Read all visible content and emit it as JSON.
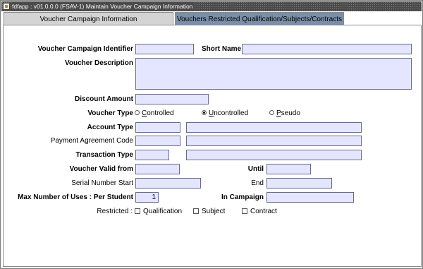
{
  "window": {
    "title": "fdfapp : v01.0.0.0 (FSAV-1) Maintain Voucher Campaign Information"
  },
  "tabs": [
    {
      "label": "Voucher Campaign Information",
      "active": true
    },
    {
      "label": "Vouchers Restricted Qualification/Subjects/Contracts",
      "active": false
    }
  ],
  "form": {
    "campaign_identifier": {
      "label": "Voucher Campaign Identifier",
      "value": ""
    },
    "short_name": {
      "label": "Short Name",
      "value": ""
    },
    "description": {
      "label": "Voucher Description",
      "value": ""
    },
    "discount_amount": {
      "label": "Discount Amount",
      "value": ""
    },
    "voucher_type": {
      "label": "Voucher Type",
      "options": [
        {
          "first": "C",
          "rest": "ontrolled",
          "selected": false
        },
        {
          "first": "U",
          "rest": "ncontrolled",
          "selected": true
        },
        {
          "first": "P",
          "rest": "seudo",
          "selected": false
        }
      ]
    },
    "account_type": {
      "label": "Account Type",
      "code": "",
      "desc": ""
    },
    "payment_agreement": {
      "label": "Payment Agreement Code",
      "code": "",
      "desc": ""
    },
    "transaction_type": {
      "label": "Transaction Type",
      "code": "",
      "desc": ""
    },
    "valid_from": {
      "label": "Voucher Valid from",
      "value": ""
    },
    "until": {
      "label": "Until",
      "value": ""
    },
    "serial_start": {
      "label": "Serial Number Start",
      "value": ""
    },
    "serial_end": {
      "label": "End",
      "value": ""
    },
    "max_uses_student": {
      "label": "Max Number of Uses : Per Student",
      "value": "1"
    },
    "max_uses_campaign": {
      "label": "In Campaign",
      "value": ""
    },
    "restricted": {
      "label": "Restricted :",
      "options": [
        {
          "label": "Qualification",
          "checked": false
        },
        {
          "label": "Subject",
          "checked": false
        },
        {
          "label": "Contract",
          "checked": false
        }
      ]
    }
  },
  "colors": {
    "field_bg": "#e4e6ff",
    "inactive_tab": "#7a8fa8",
    "active_tab": "#d4d4d4",
    "titlebar": "#4a4a4a"
  }
}
